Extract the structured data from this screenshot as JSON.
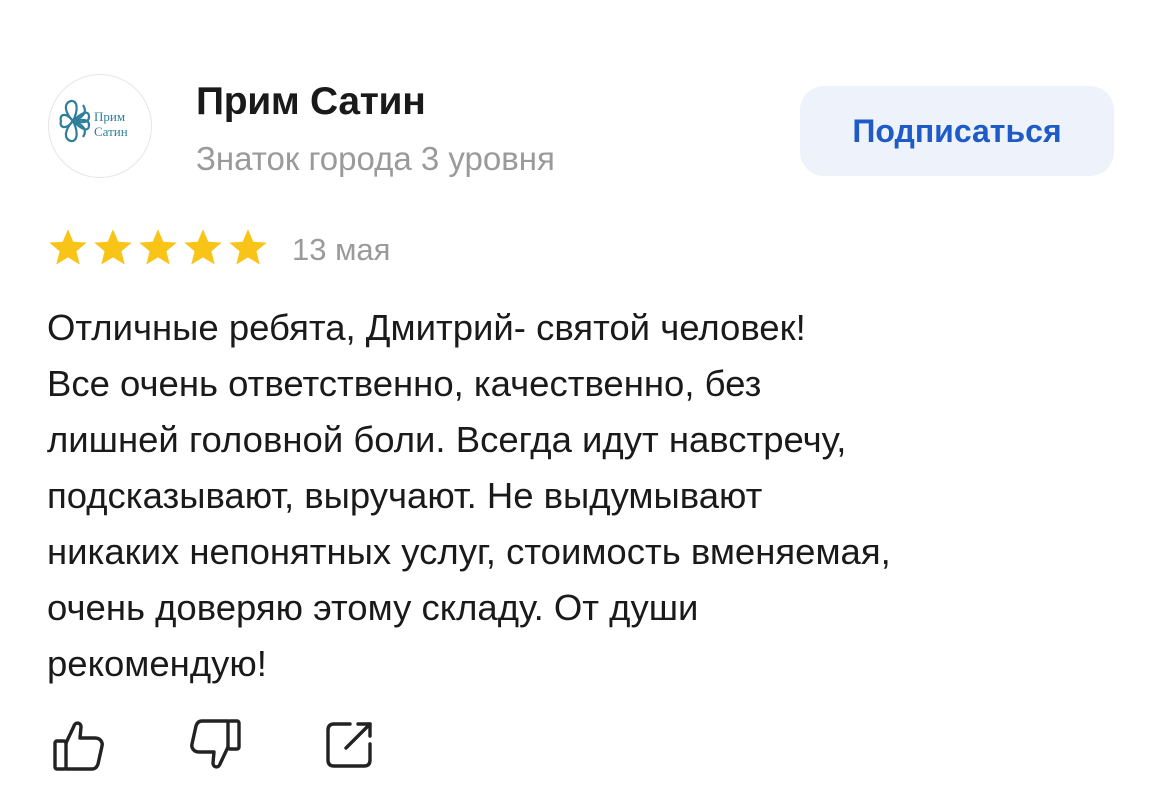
{
  "author": {
    "name": "Прим Сатин",
    "level": "Знаток города 3 уровня",
    "logo_text": [
      "Прим",
      "Сатин"
    ],
    "logo_color": "#2f7f9a"
  },
  "subscribe": {
    "label": "Подписаться",
    "color": "#1f5bc7",
    "background": "#eef3fb"
  },
  "review": {
    "rating": 5,
    "rating_max": 5,
    "star_color": "#f8c418",
    "date": "13 мая",
    "text_lines": [
      "Отличные ребята, Дмитрий- святой человек!",
      "Все очень ответственно, качественно, без",
      "лишней головной боли. Всегда идут навстречу,",
      "подсказывают, выручают. Не выдумывают",
      "никаких непонятных услуг, стоимость вменяемая,",
      "очень доверяю этому складу. От души",
      "рекомендую!"
    ]
  },
  "actions": [
    {
      "icon": "thumbs-up-icon"
    },
    {
      "icon": "thumbs-down-icon"
    },
    {
      "icon": "share-icon"
    }
  ]
}
